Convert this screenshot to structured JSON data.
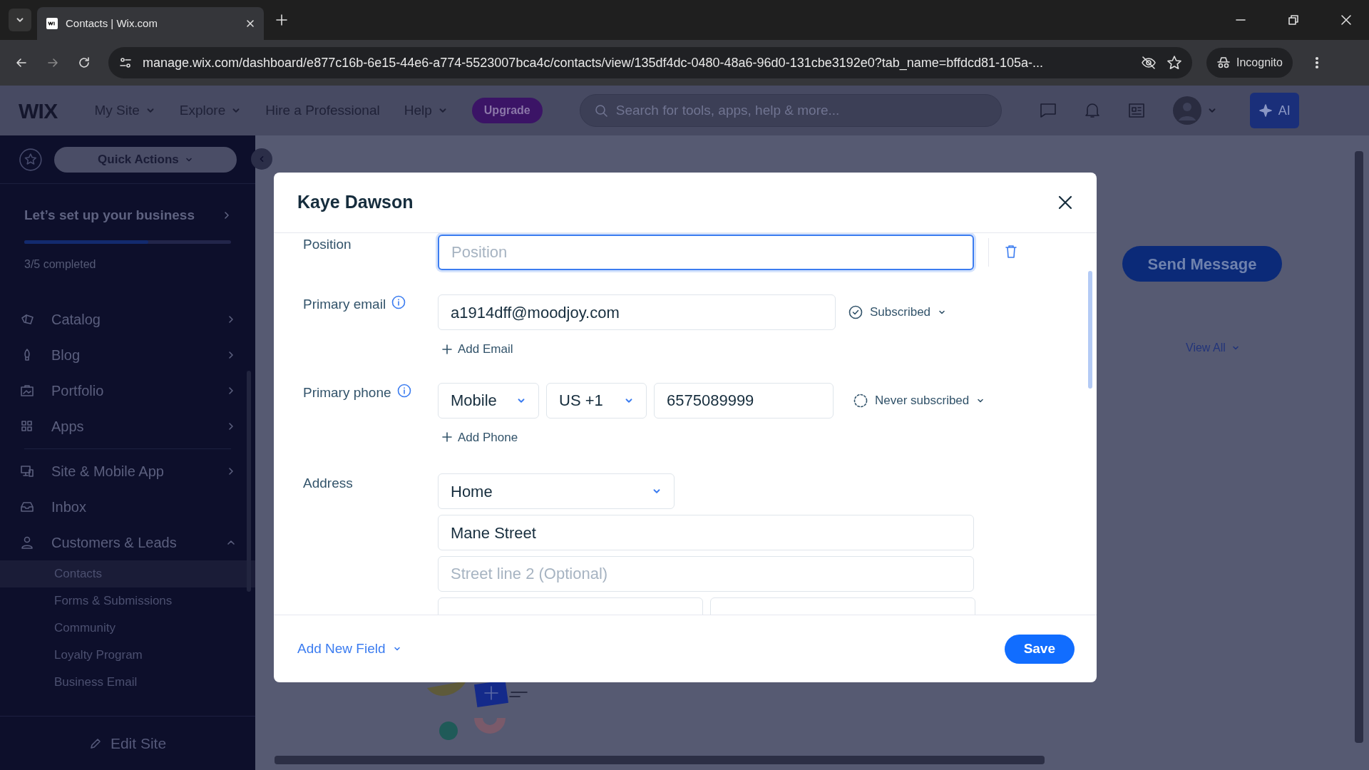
{
  "browser": {
    "tabs": [
      {
        "title": "Contacts | Wix.com",
        "selected": true
      }
    ],
    "url": "manage.wix.com/dashboard/e877c16b-6e15-44e6-a774-5523007bca4c/contacts/view/135df4dc-0480-48a6-96d0-131cbe3192e0?tab_name=bffdcd81-105a-...",
    "incognito": "Incognito"
  },
  "topbar": {
    "logo": "WIX",
    "nav": [
      {
        "label": "My Site",
        "dropdown": true
      },
      {
        "label": "Explore",
        "dropdown": true
      },
      {
        "label": "Hire a Professional",
        "dropdown": false
      },
      {
        "label": "Help",
        "dropdown": true
      }
    ],
    "upgrade": "Upgrade",
    "search": {
      "placeholder": "Search for tools, apps, help & more..."
    },
    "ai": "AI"
  },
  "sidebar": {
    "quick_actions": "Quick Actions",
    "setup": {
      "title": "Let’s set up your business",
      "level": 0.6,
      "progress": "3/5 completed"
    },
    "groups": [
      [
        {
          "label": "Catalog",
          "expanded": false
        },
        {
          "label": "Blog",
          "expanded": false
        },
        {
          "label": "Portfolio",
          "expanded": false
        },
        {
          "label": "Apps",
          "expanded": false
        }
      ],
      [
        {
          "label": "Site & Mobile App",
          "expanded": false
        },
        {
          "label": "Inbox"
        },
        {
          "label": "Customers & Leads",
          "expanded": true,
          "children": [
            {
              "label": "Contacts",
              "selected": true
            },
            {
              "label": "Forms & Submissions",
              "selected": false
            },
            {
              "label": "Community",
              "selected": false
            },
            {
              "label": "Loyalty Program",
              "selected": false
            },
            {
              "label": "Business Email",
              "selected": false
            }
          ]
        }
      ]
    ],
    "edit_site": "Edit Site"
  },
  "background": {
    "send_message": "Send Message",
    "view_all": "View All"
  },
  "modal": {
    "title": "Kaye Dawson",
    "position": {
      "label": "Position",
      "placeholder": "Position",
      "focused": true
    },
    "email": {
      "label": "Primary email",
      "value": "a1914dff@moodjoy.com",
      "status": "Subscribed",
      "subscribed": true,
      "add": "Add Email"
    },
    "phone": {
      "label": "Primary phone",
      "type": "Mobile",
      "country": "US +1",
      "value": "6575089999",
      "status": "Never subscribed",
      "subscribed": false,
      "add": "Add Phone"
    },
    "address": {
      "label": "Address",
      "type": "Home",
      "street": "Mane Street",
      "street2_placeholder": "Street line 2 (Optional)"
    },
    "add_field": "Add New Field",
    "save": "Save"
  }
}
